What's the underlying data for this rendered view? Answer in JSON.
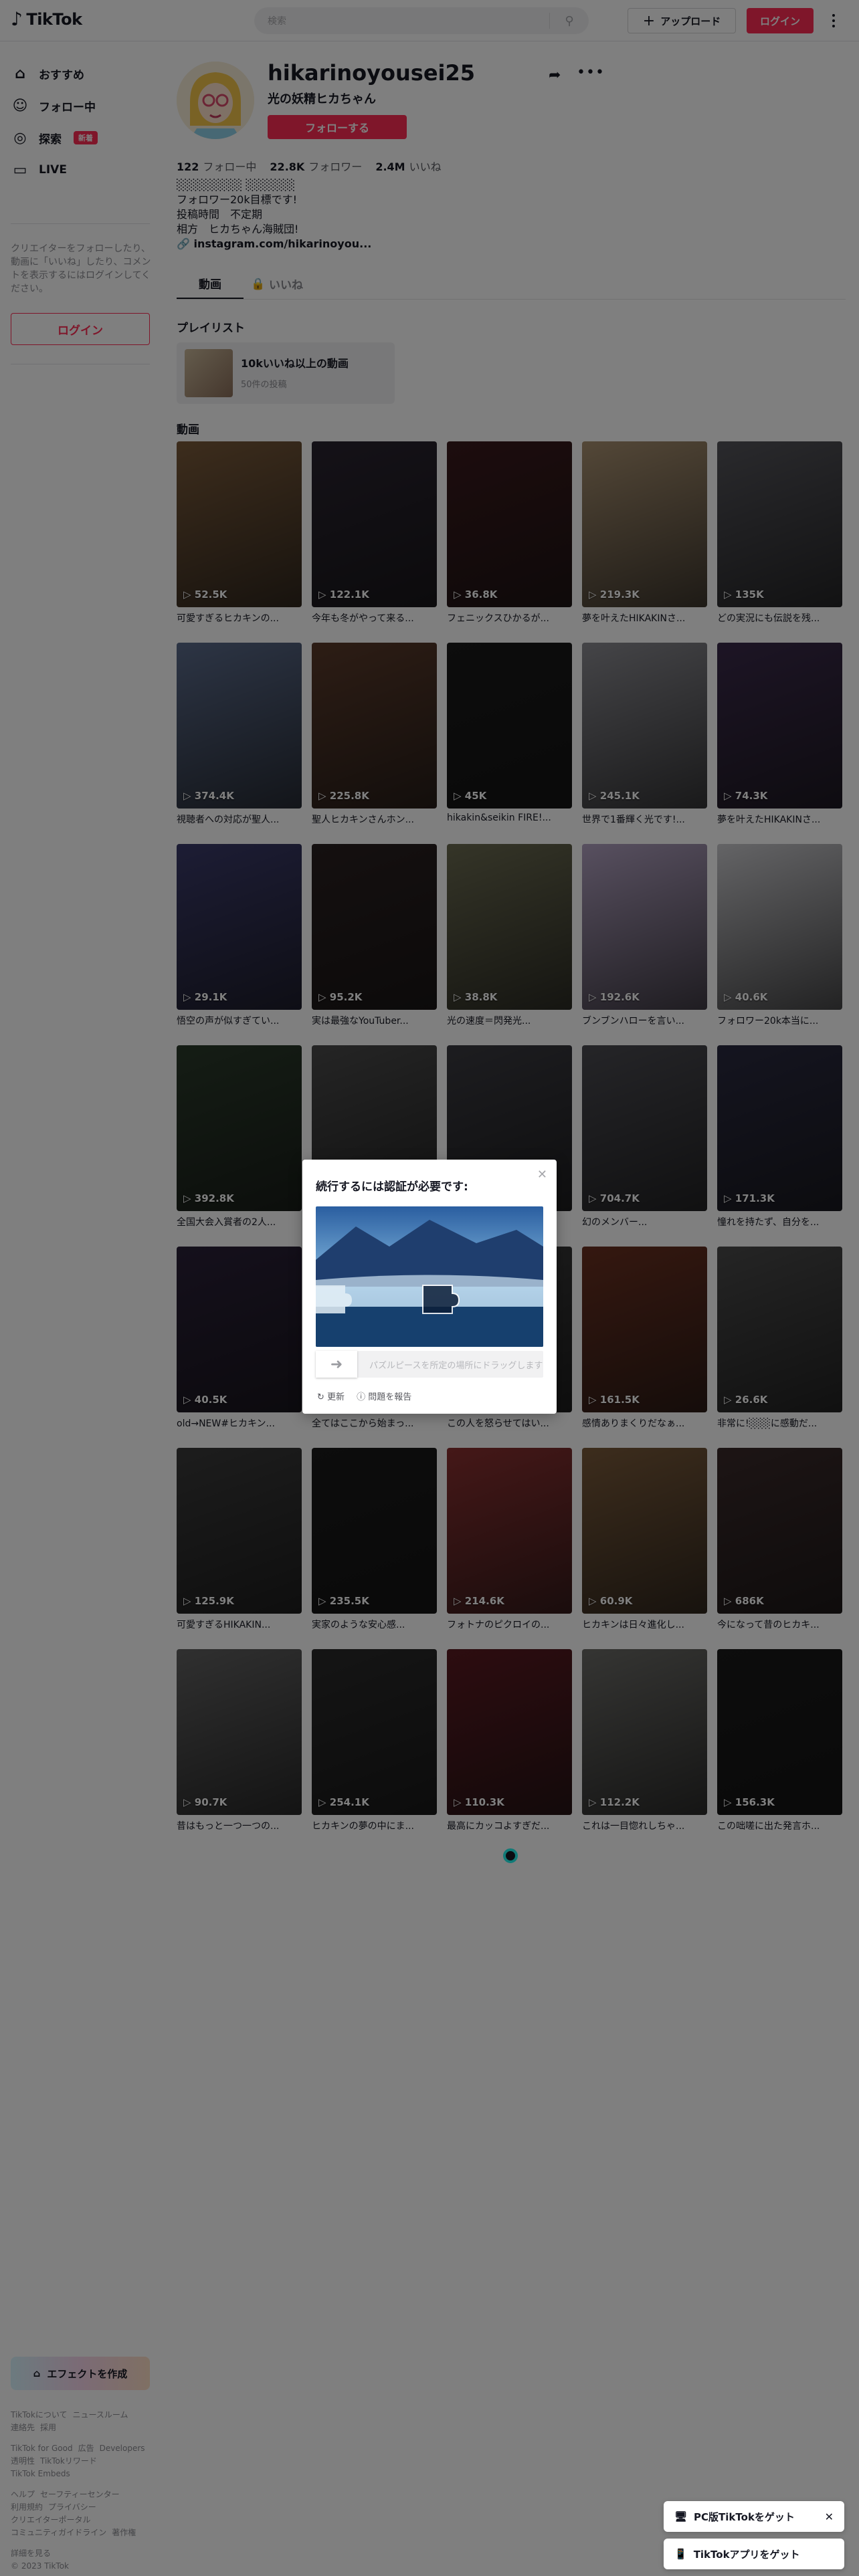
{
  "header": {
    "logo": "TikTok",
    "search_placeholder": "検索",
    "upload_label": "アップロード",
    "login_label": "ログイン"
  },
  "sidebar": {
    "items": [
      {
        "label": "おすすめ",
        "icon": "home-icon"
      },
      {
        "label": "フォロー中",
        "icon": "following-icon"
      },
      {
        "label": "探索",
        "icon": "compass-icon",
        "badge": "新着"
      },
      {
        "label": "LIVE",
        "icon": "live-icon"
      }
    ],
    "note": "クリエイターをフォローしたり、動画に「いいね」したり、コメントを表示するにはログインしてください。",
    "login_label": "ログイン",
    "effect_label": "エフェクトを作成",
    "footer": {
      "group1": [
        "TikTokについて",
        "ニュースルーム",
        "連絡先",
        "採用"
      ],
      "group2": [
        "TikTok for Good",
        "広告",
        "Developers",
        "透明性",
        "TikTokリワード",
        "TikTok Embeds"
      ],
      "group3": [
        "ヘルプ",
        "セーフティーセンター",
        "利用規約",
        "プライバシー",
        "クリエイターポータル",
        "コミュニティガイドライン",
        "著作権"
      ],
      "more": "詳細を見る",
      "copyright": "© 2023 TikTok"
    }
  },
  "profile": {
    "username": "hikarinoyousei25",
    "nickname": "光の妖精ヒカちゃん",
    "follow_label": "フォローする",
    "stats": {
      "following": "122",
      "following_label": "フォロー中",
      "followers": "22.8K",
      "followers_label": "フォロワー",
      "likes": "2.4M",
      "likes_label": "いいね"
    },
    "bio": [
      "░░░░░░░░ ░░░░░░",
      "フォロワー20k目標です!",
      "投稿時間　不定期",
      "相方　ヒカちゃん海賊団!"
    ],
    "link": "instagram.com/hikarinoyou...",
    "tabs": [
      "動画",
      "いいね"
    ]
  },
  "playlist": {
    "heading": "プレイリスト",
    "title": "10kいいね以上の動画",
    "count": "50件の投稿"
  },
  "videos": {
    "heading": "動画",
    "items": [
      {
        "views": "52.5K",
        "caption": "可愛すぎるヒカキンの...",
        "bg": "#7a5a3a"
      },
      {
        "views": "122.1K",
        "caption": "今年も冬がやって来る...",
        "bg": "#2a2430"
      },
      {
        "views": "36.8K",
        "caption": "フェニックスひかるが...",
        "bg": "#3a1a1c"
      },
      {
        "views": "219.3K",
        "caption": "夢を叶えたHIKAKINさ...",
        "bg": "#a89070"
      },
      {
        "views": "135K",
        "caption": "どの実況にも伝説を残...",
        "bg": "#54545a"
      },
      {
        "views": "374.4K",
        "caption": "視聴者への対応が聖人...",
        "bg": "#5a6a8a"
      },
      {
        "views": "225.8K",
        "caption": "聖人ヒカキンさんホン...",
        "bg": "#5a3a2a"
      },
      {
        "views": "45K",
        "caption": "hikakin&seikin FIRE!...",
        "bg": "#1a1a1a"
      },
      {
        "views": "245.1K",
        "caption": "世界で1番輝く光です!...",
        "bg": "#8a8a90"
      },
      {
        "views": "74.3K",
        "caption": "夢を叶えたHIKAKINさ...",
        "bg": "#3a2a4a"
      },
      {
        "views": "29.1K",
        "caption": "悟空の声が似すぎてい...",
        "bg": "#3a3a6a"
      },
      {
        "views": "95.2K",
        "caption": "実は最強なYouTuber...",
        "bg": "#2a2020"
      },
      {
        "views": "38.8K",
        "caption": "光の速度＝閃発光...",
        "bg": "#6a6a50"
      },
      {
        "views": "192.6K",
        "caption": "ブンブンハローを言い...",
        "bg": "#b0a0c0"
      },
      {
        "views": "40.6K",
        "caption": "フォロワー20k本当に...",
        "bg": "#c8c8cc"
      },
      {
        "views": "392.8K",
        "caption": "全国大会入賞者の2人...",
        "bg": "#2a3a2a"
      },
      {
        "views": "",
        "caption": "",
        "bg": "#4a4a4a"
      },
      {
        "views": "",
        "caption": "",
        "bg": "#3a3a40"
      },
      {
        "views": "704.7K",
        "caption": "幻のメンバー...",
        "bg": "#4a4a50"
      },
      {
        "views": "171.3K",
        "caption": "憧れを持たず、自分を...",
        "bg": "#2a2a40"
      },
      {
        "views": "40.5K",
        "caption": "old→NEW#ヒカキン...",
        "bg": "#2a2038"
      },
      {
        "views": "",
        "caption": "全てはここから始まっ...",
        "bg": "#4a4a4a"
      },
      {
        "views": "",
        "caption": "この人を怒らせてはい...",
        "bg": "#3a3a3a"
      },
      {
        "views": "161.5K",
        "caption": "感情ありまくりだなぁ...",
        "bg": "#6a3020"
      },
      {
        "views": "26.6K",
        "caption": "非常に!░░░に感動だ...",
        "bg": "#4a4a4a"
      },
      {
        "views": "125.9K",
        "caption": "可愛すぎるHIKAKIN...",
        "bg": "#3a3a3a"
      },
      {
        "views": "235.5K",
        "caption": "実家のような安心感...",
        "bg": "#1a1a1a"
      },
      {
        "views": "214.6K",
        "caption": "フォトナのピクロイの...",
        "bg": "#8a3030"
      },
      {
        "views": "60.9K",
        "caption": "ヒカキンは日々進化し...",
        "bg": "#7a5a3a"
      },
      {
        "views": "686K",
        "caption": "今になって昔のヒカキ...",
        "bg": "#3a2a2a"
      },
      {
        "views": "90.7K",
        "caption": "昔はもっと一つ一つの...",
        "bg": "#606060"
      },
      {
        "views": "254.1K",
        "caption": "ヒカキンの夢の中にま...",
        "bg": "#2a2a2a"
      },
      {
        "views": "110.3K",
        "caption": "最高にカッコよすぎだ...",
        "bg": "#5a1a20"
      },
      {
        "views": "112.2K",
        "caption": "これは一目惚れしちゃ...",
        "bg": "#6a6a66"
      },
      {
        "views": "156.3K",
        "caption": "この咄嗟に出た発言ホ...",
        "bg": "#1a1a1a"
      }
    ]
  },
  "captcha": {
    "title": "続行するには認証が必要です:",
    "slider_text": "パズルピースを所定の場所にドラッグします",
    "refresh_label": "更新",
    "report_label": "問題を報告"
  },
  "getapp": {
    "pc_label": "PC版TikTokをゲット",
    "app_label": "TikTokアプリをゲット"
  }
}
